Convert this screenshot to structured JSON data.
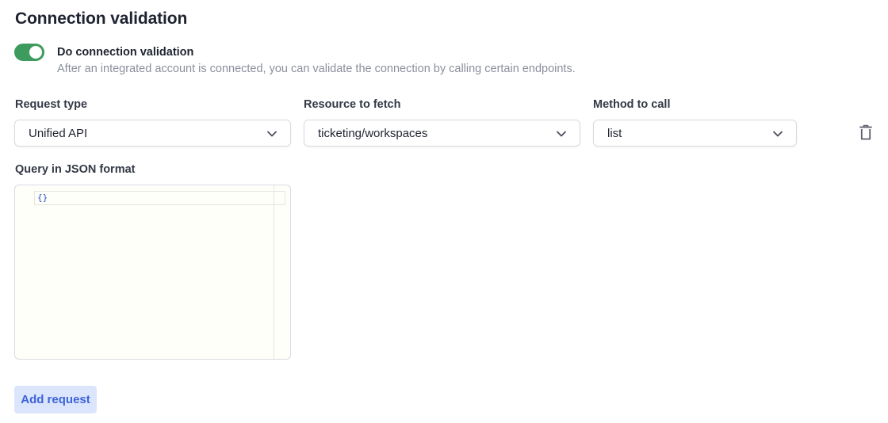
{
  "section": {
    "title": "Connection validation"
  },
  "validation_toggle": {
    "enabled": true,
    "title": "Do connection validation",
    "description": "After an integrated account is connected, you can validate the connection by calling certain endpoints."
  },
  "request": {
    "request_type": {
      "label": "Request type",
      "value": "Unified API"
    },
    "resource": {
      "label": "Resource to fetch",
      "value": "ticketing/workspaces"
    },
    "method": {
      "label": "Method to call",
      "value": "list"
    },
    "query": {
      "label": "Query in JSON format",
      "value": "{}"
    }
  },
  "actions": {
    "add_request_label": "Add request"
  },
  "colors": {
    "toggle_on": "#3d9b5e",
    "accent": "#3e63d9",
    "button_bg": "#dbe5fb"
  },
  "icons": {
    "dropdown": "chevron-down-icon",
    "delete": "trash-icon"
  }
}
